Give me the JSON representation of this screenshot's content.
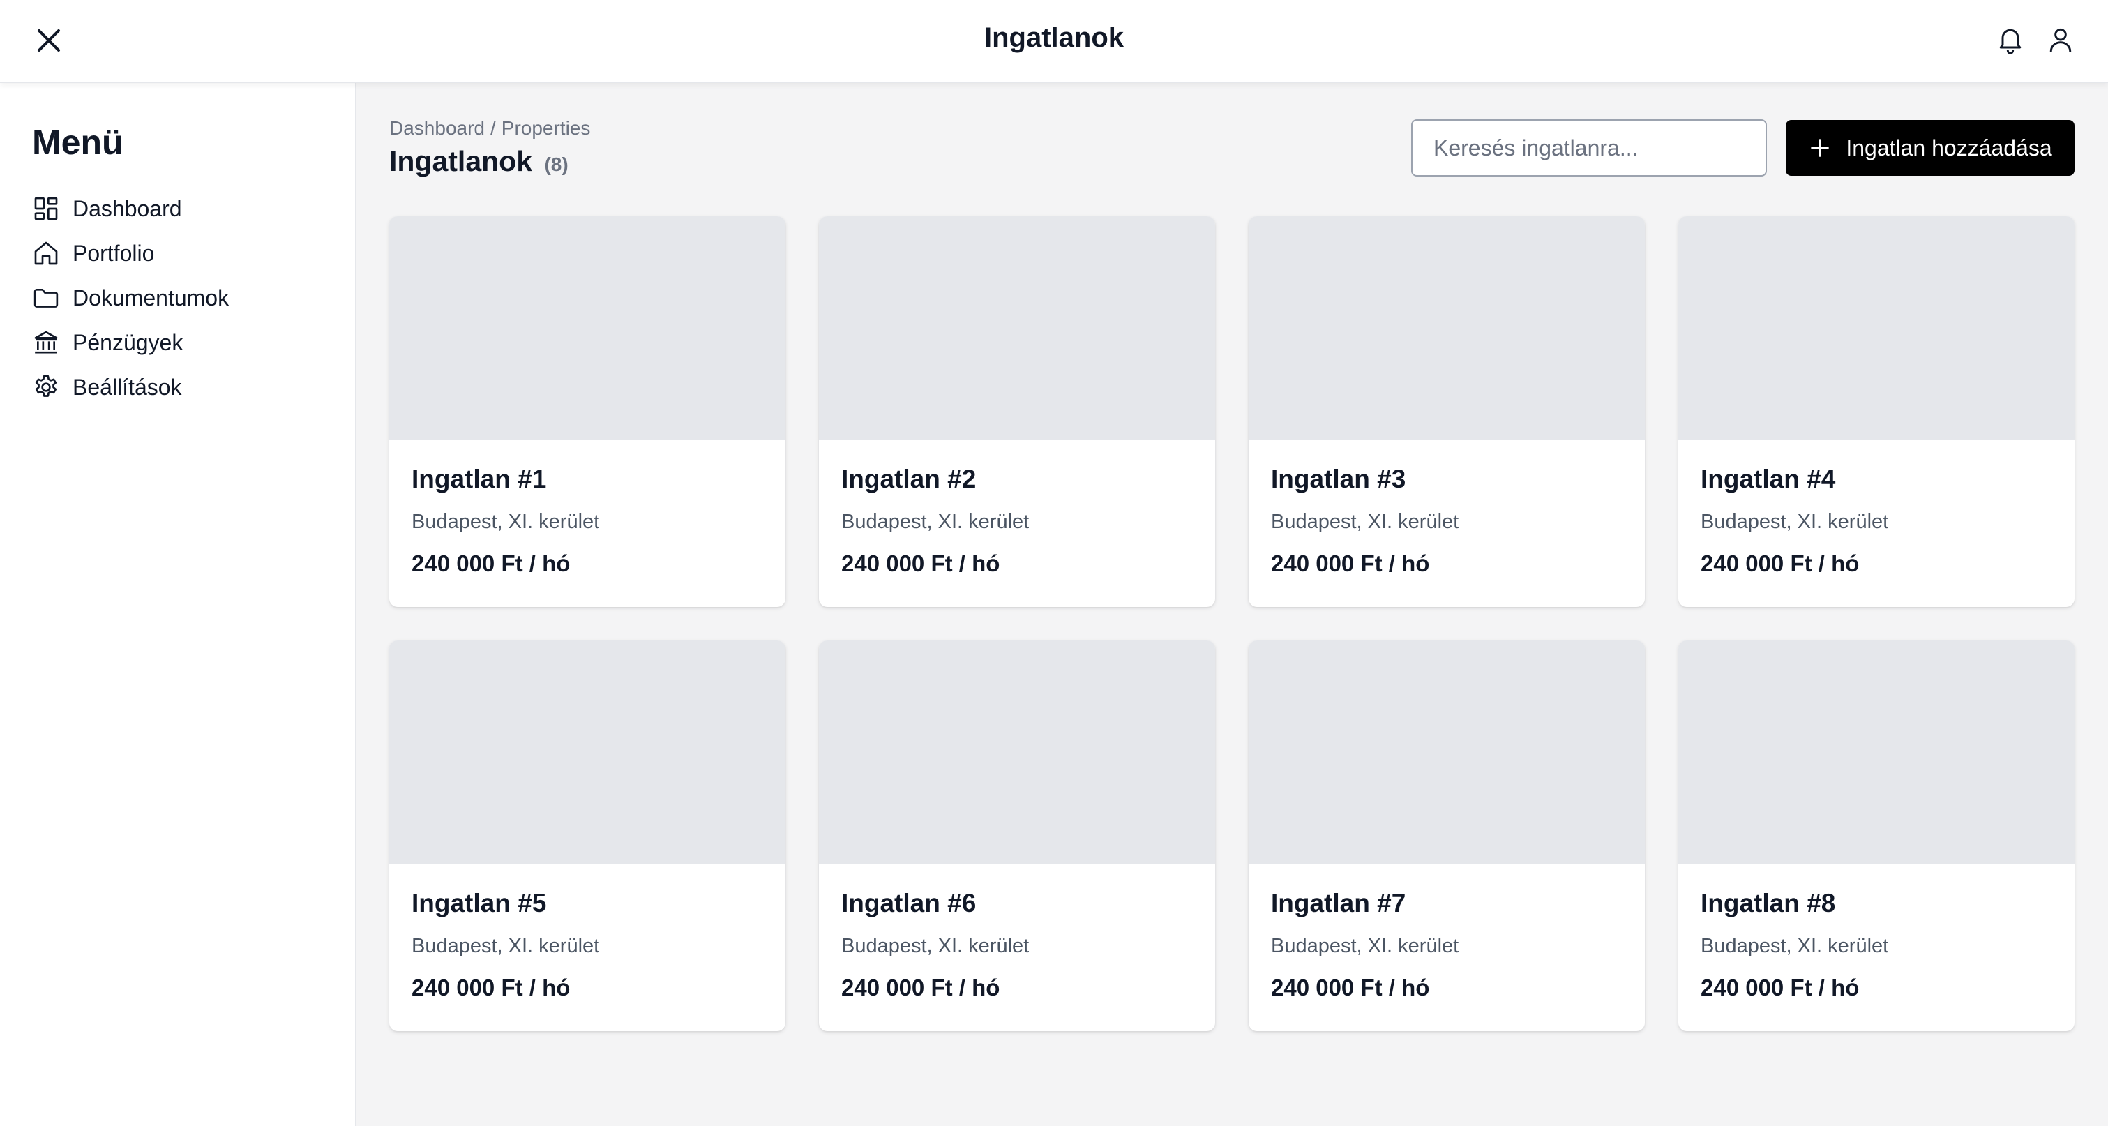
{
  "header": {
    "title": "Ingatlanok"
  },
  "sidebar": {
    "title": "Menü",
    "items": [
      {
        "label": "Dashboard",
        "icon": "dashboard-icon"
      },
      {
        "label": "Portfolio",
        "icon": "home-icon"
      },
      {
        "label": "Dokumentumok",
        "icon": "folder-icon"
      },
      {
        "label": "Pénzügyek",
        "icon": "bank-icon"
      },
      {
        "label": "Beállítások",
        "icon": "gear-icon"
      }
    ]
  },
  "main": {
    "breadcrumb": {
      "first": "Dashboard",
      "separator": "/",
      "second": "Properties"
    },
    "title": "Ingatlanok",
    "count": "(8)",
    "search": {
      "placeholder": "Keresés ingatlanra...",
      "value": ""
    },
    "add_button": "Ingatlan hozzáadása",
    "properties": [
      {
        "name": "Ingatlan #1",
        "location": "Budapest, XI. kerület",
        "price": "240 000 Ft / hó"
      },
      {
        "name": "Ingatlan #2",
        "location": "Budapest, XI. kerület",
        "price": "240 000 Ft / hó"
      },
      {
        "name": "Ingatlan #3",
        "location": "Budapest, XI. kerület",
        "price": "240 000 Ft / hó"
      },
      {
        "name": "Ingatlan #4",
        "location": "Budapest, XI. kerület",
        "price": "240 000 Ft / hó"
      },
      {
        "name": "Ingatlan #5",
        "location": "Budapest, XI. kerület",
        "price": "240 000 Ft / hó"
      },
      {
        "name": "Ingatlan #6",
        "location": "Budapest, XI. kerület",
        "price": "240 000 Ft / hó"
      },
      {
        "name": "Ingatlan #7",
        "location": "Budapest, XI. kerület",
        "price": "240 000 Ft / hó"
      },
      {
        "name": "Ingatlan #8",
        "location": "Budapest, XI. kerület",
        "price": "240 000 Ft / hó"
      }
    ]
  },
  "colors": {
    "accent": "#000000",
    "background": "#f4f4f5",
    "card_image_placeholder": "#e5e7eb",
    "muted_text": "#6b7280"
  }
}
